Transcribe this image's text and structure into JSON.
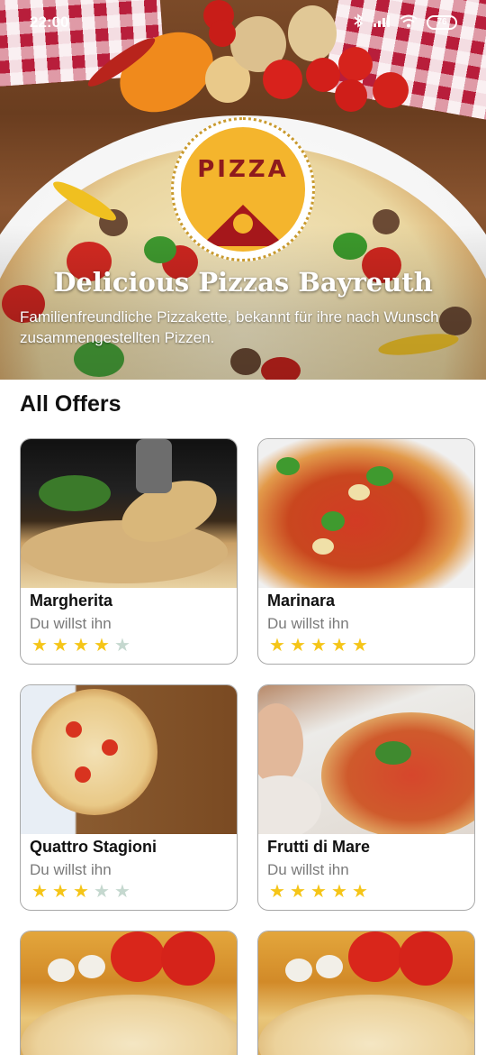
{
  "status_bar": {
    "time": "22:00",
    "battery": "76",
    "icons": [
      "bluetooth-icon",
      "signal-icon",
      "wifi-icon",
      "battery-icon"
    ]
  },
  "hero": {
    "logo_text": "PIZZA",
    "title": "Delicious Pizzas Bayreuth",
    "subtitle": "Familienfreundliche Pizzakette, bekannt für ihre nach Wunsch zusammengestellten Pizzen."
  },
  "offers": {
    "heading": "All Offers",
    "items": [
      {
        "name": "Margherita",
        "subtitle": "Du willst ihn",
        "rating": 4,
        "max": 5
      },
      {
        "name": "Marinara",
        "subtitle": "Du willst ihn",
        "rating": 5,
        "max": 5
      },
      {
        "name": "Quattro Stagioni",
        "subtitle": "Du willst ihn",
        "rating": 3,
        "max": 5
      },
      {
        "name": "Frutti di Mare",
        "subtitle": "Du willst ihn",
        "rating": 5,
        "max": 5
      }
    ]
  },
  "colors": {
    "star_on": "#f5c518",
    "star_off": "#c5d8cf",
    "logo_bg": "#f4b52d",
    "logo_red": "#a5171b"
  }
}
